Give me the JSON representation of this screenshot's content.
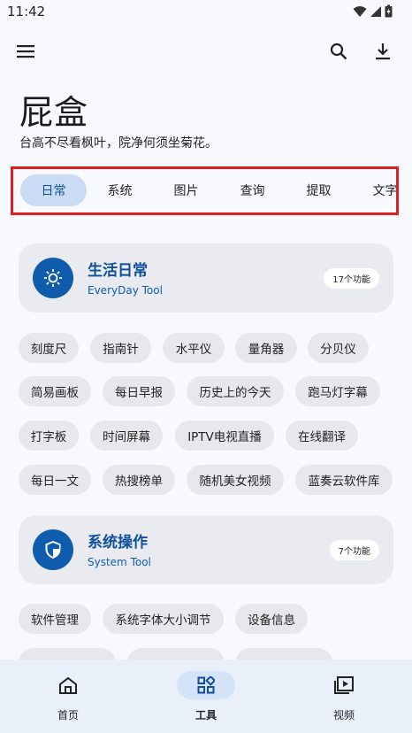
{
  "status_bar": {
    "time": "11:42"
  },
  "app": {
    "title": "屁盒",
    "subtitle": "台高不尽看枫叶，院净何须坐菊花。"
  },
  "tabs": [
    {
      "label": "日常",
      "active": true
    },
    {
      "label": "系统",
      "active": false
    },
    {
      "label": "图片",
      "active": false
    },
    {
      "label": "查询",
      "active": false
    },
    {
      "label": "提取",
      "active": false
    },
    {
      "label": "文字",
      "active": false
    }
  ],
  "sections": [
    {
      "title": "生活日常",
      "subtitle": "EveryDay Tool",
      "count": "17个功能",
      "icon": "sun-icon",
      "chips": [
        [
          "刻度尺",
          "指南针",
          "水平仪",
          "量角器",
          "分贝仪"
        ],
        [
          "简易画板",
          "每日早报",
          "历史上的今天",
          "跑马灯字幕"
        ],
        [
          "打字板",
          "时间屏幕",
          "IPTV电视直播",
          "在线翻译"
        ],
        [
          "每日一文",
          "热搜榜单",
          "随机美女视频",
          "蓝奏云软件库"
        ]
      ]
    },
    {
      "title": "系统操作",
      "subtitle": "System Tool",
      "count": "7个功能",
      "icon": "shield-icon",
      "chips": [
        [
          "软件管理",
          "系统字体大小调节",
          "设备信息"
        ]
      ]
    }
  ],
  "bottom_nav": [
    {
      "label": "首页",
      "icon": "home-icon",
      "active": false
    },
    {
      "label": "工具",
      "icon": "grid-icon",
      "active": true
    },
    {
      "label": "视频",
      "icon": "video-icon",
      "active": false
    }
  ],
  "colors": {
    "accent": "#0f5cad",
    "highlight_border": "#e01e1e",
    "active_tab": "#c9dcf4"
  }
}
